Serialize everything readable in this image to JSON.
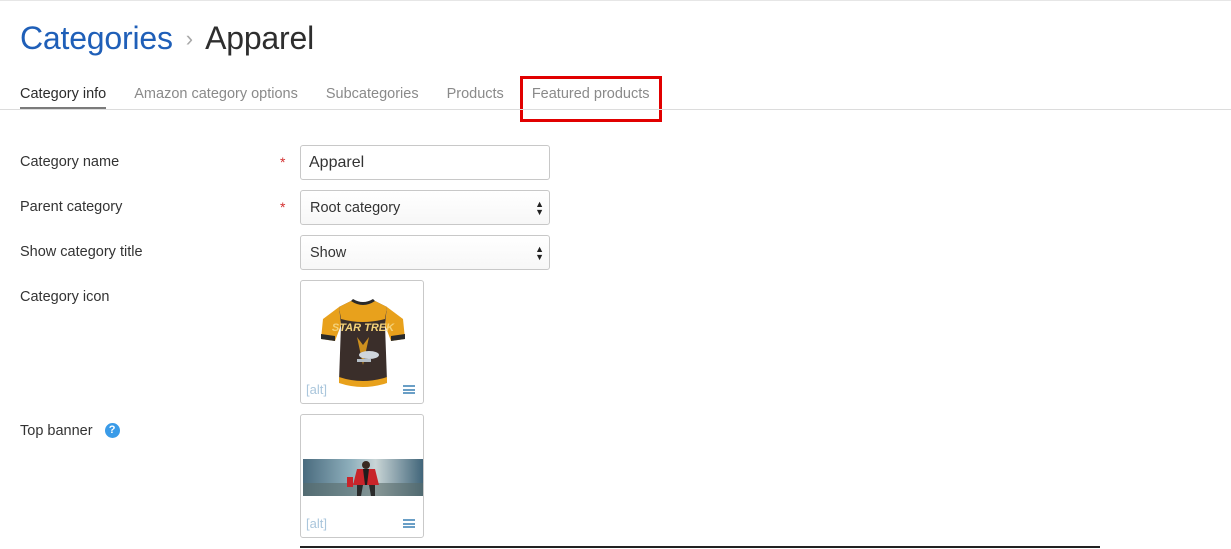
{
  "breadcrumb": {
    "parent": "Categories",
    "separator": "›",
    "current": "Apparel"
  },
  "tabs": [
    {
      "label": "Category info",
      "active": true
    },
    {
      "label": "Amazon category options",
      "active": false
    },
    {
      "label": "Subcategories",
      "active": false
    },
    {
      "label": "Products",
      "active": false
    },
    {
      "label": "Featured products",
      "active": false,
      "highlighted": true
    }
  ],
  "form": {
    "category_name": {
      "label": "Category name",
      "required": "*",
      "value": "Apparel"
    },
    "parent_category": {
      "label": "Parent category",
      "required": "*",
      "value": "Root category"
    },
    "show_category_title": {
      "label": "Show category title",
      "value": "Show"
    },
    "category_icon": {
      "label": "Category icon",
      "alt": "[alt]",
      "image": "Star Trek cycling jersey"
    },
    "top_banner": {
      "label": "Top banner",
      "help": "?",
      "alt": "[alt]",
      "image": "person in red jacket banner"
    }
  },
  "colors": {
    "link": "#1f5fb8",
    "highlight": "#e10000",
    "help": "#3a9be8",
    "required": "#d32f2f"
  }
}
